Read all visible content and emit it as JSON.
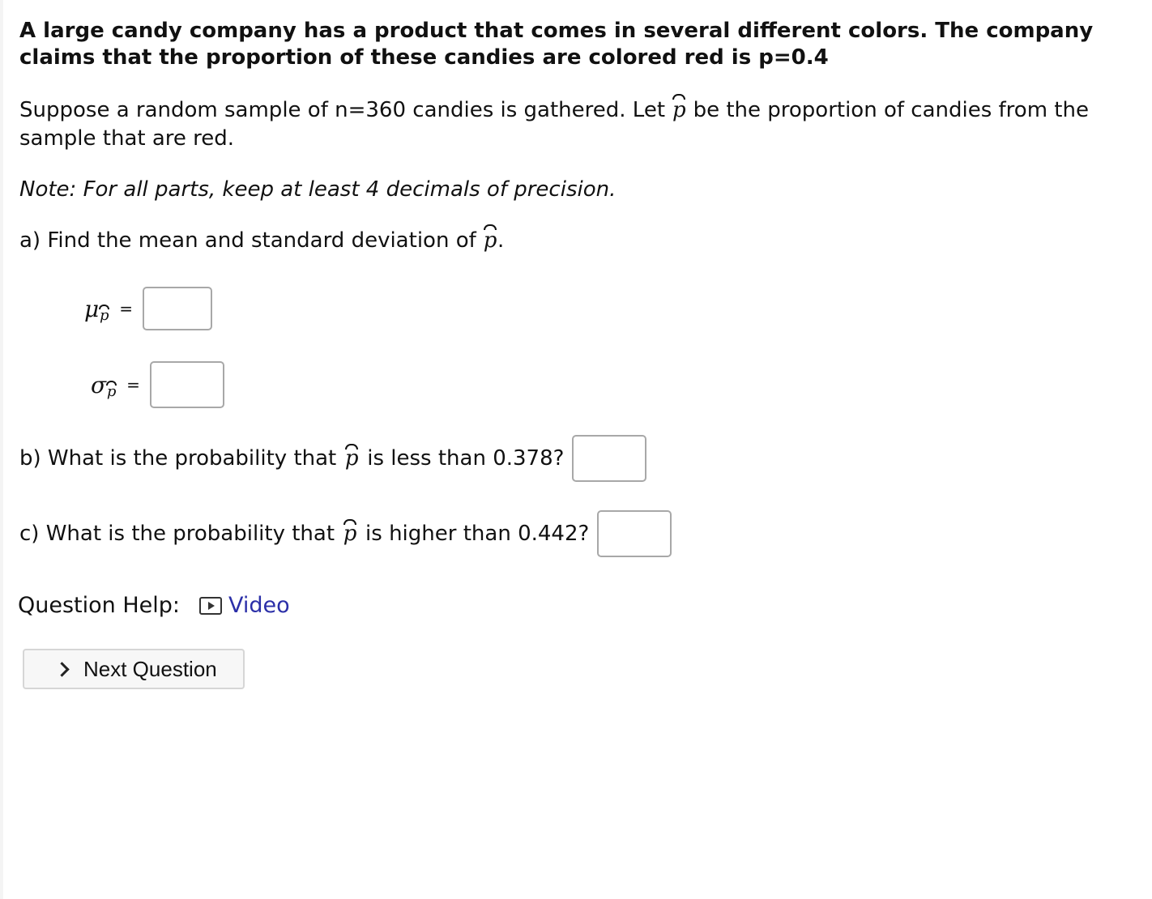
{
  "question": {
    "intro": "A large candy company has a product that comes in several different colors. The company claims that the proportion of these candies are colored red is p=0.4",
    "sample_before": "Suppose a random sample of n=360 candies is gathered. Let",
    "sample_after": "be the proportion of candies from the sample that are red.",
    "note": "Note: For all parts, keep at least 4 decimals of precision.",
    "part_a": "a) Find the mean and standard deviation of",
    "part_a_end": ".",
    "mu_symbol": "μ",
    "sigma_symbol": "σ",
    "p_symbol": "p",
    "equals": "=",
    "part_b_before": "b) What is the probability that",
    "part_b_after": "is less than 0.378?",
    "part_c_before": "c) What is the probability that",
    "part_c_after": "is higher than 0.442?"
  },
  "answers": {
    "mean": "",
    "sd": "",
    "b": "",
    "c": ""
  },
  "help": {
    "label": "Question Help:",
    "video_icon": "video-play-icon",
    "video_label": "Video"
  },
  "next": {
    "icon": "chevron-right-icon",
    "label": "Next Question"
  }
}
